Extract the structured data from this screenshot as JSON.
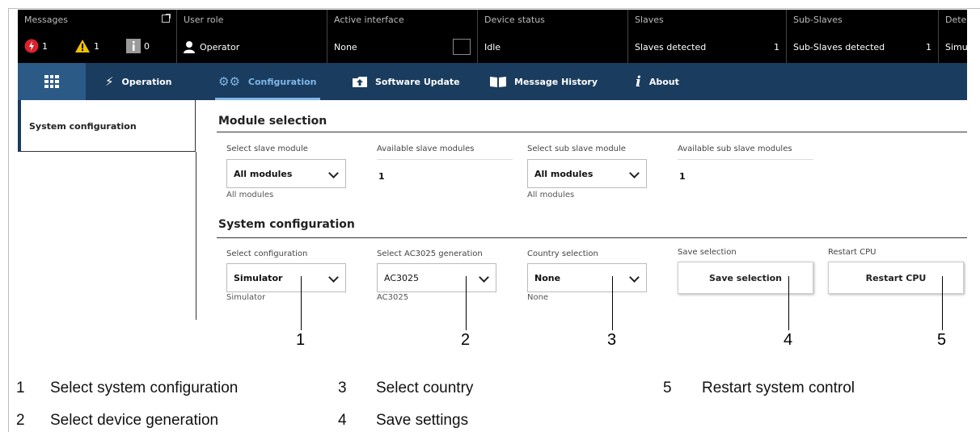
{
  "statusbar": {
    "messages": {
      "header": "Messages",
      "errors": "1",
      "warnings": "1",
      "info": "0"
    },
    "user_role": {
      "header": "User role",
      "value": "Operator"
    },
    "active_interface": {
      "header": "Active interface",
      "value": "None"
    },
    "device_status": {
      "header": "Device status",
      "value": "Idle"
    },
    "slaves": {
      "header": "Slaves",
      "label": "Slaves detected",
      "count": "1"
    },
    "sub_slaves": {
      "header": "Sub-Slaves",
      "label": "Sub-Slaves detected",
      "count": "1"
    },
    "detection": {
      "header": "Dete",
      "value": "Simu"
    }
  },
  "nav": {
    "items": [
      {
        "label": "Operation",
        "icon": "bolt-icon"
      },
      {
        "label": "Configuration",
        "icon": "gears-icon"
      },
      {
        "label": "Software Update",
        "icon": "upload-icon"
      },
      {
        "label": "Message History",
        "icon": "book-icon"
      },
      {
        "label": "About",
        "icon": "info-icon"
      }
    ]
  },
  "sidebar": {
    "items": [
      {
        "label": "System configuration"
      }
    ]
  },
  "module_selection": {
    "title": "Module selection",
    "slave_select": {
      "label": "Select slave module",
      "value": "All modules",
      "sub": "All modules"
    },
    "available_slave": {
      "label": "Available slave modules",
      "value": "1"
    },
    "sub_slave_select": {
      "label": "Select sub slave module",
      "value": "All modules",
      "sub": "All modules"
    },
    "available_sub_slave": {
      "label": "Available sub slave modules",
      "value": "1"
    }
  },
  "system_configuration": {
    "title": "System configuration",
    "config_select": {
      "label": "Select configuration",
      "value": "Simulator",
      "sub": "Simulator"
    },
    "generation_select": {
      "label": "Select AC3025 generation",
      "value": "AC3025",
      "sub": "AC3025"
    },
    "country_select": {
      "label": "Country selection",
      "value": "None",
      "sub": "None"
    },
    "save": {
      "label": "Save selection",
      "button": "Save selection"
    },
    "restart": {
      "label": "Restart CPU",
      "button": "Restart CPU"
    }
  },
  "callouts": [
    "1",
    "2",
    "3",
    "4",
    "5"
  ],
  "legend": [
    {
      "num": "1",
      "text": "Select system configuration"
    },
    {
      "num": "2",
      "text": "Select device generation"
    },
    {
      "num": "3",
      "text": "Select country"
    },
    {
      "num": "4",
      "text": "Save settings"
    },
    {
      "num": "5",
      "text": "Restart system control"
    }
  ],
  "colors": {
    "statusbar_bg": "#000000",
    "navbar_bg": "#1a3c5e",
    "nav_active": "#7fb7e8",
    "error": "#d9232e",
    "warning": "#f2c200"
  }
}
